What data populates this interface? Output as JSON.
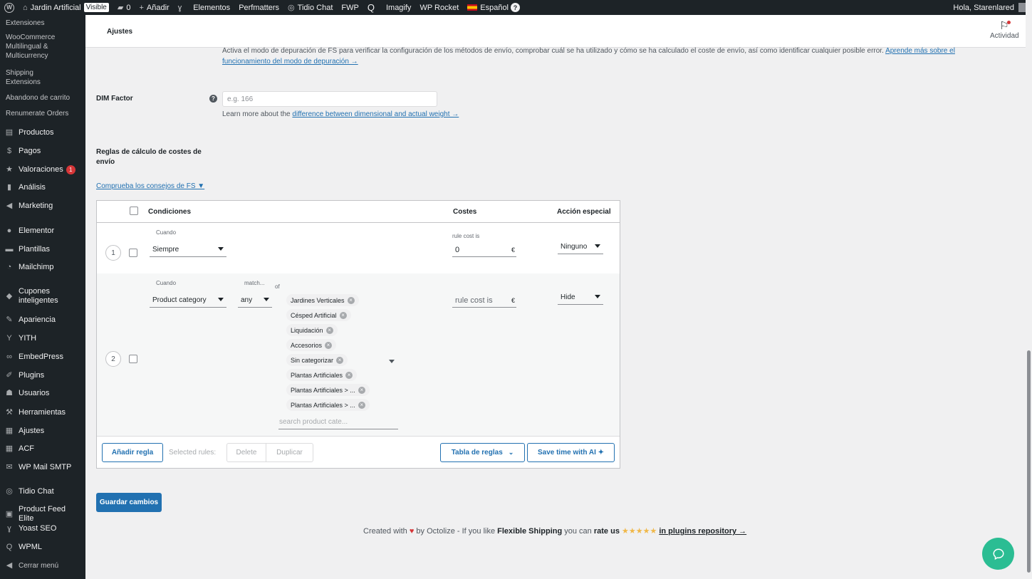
{
  "adminbar": {
    "site_name": "Jardin Artificial",
    "visible_badge": "Visible",
    "comments_count": "0",
    "add_new": "Añadir",
    "items": [
      "Elementos",
      "Perfmatters",
      "Tidio Chat",
      "FWP",
      "Imagify",
      "WP Rocket"
    ],
    "language": "Español",
    "greeting": "Hola, Starenlared"
  },
  "sidebar": {
    "subitems": [
      "Extensiones",
      "WooCommerce Multilingual & Multicurrency",
      "Shipping Extensions",
      "Abandono de carrito",
      "Renumerate Orders"
    ],
    "items": [
      {
        "label": "Productos",
        "icon": "archive-icon"
      },
      {
        "label": "Pagos",
        "icon": "dollar-icon"
      },
      {
        "label": "Valoraciones",
        "icon": "star-icon",
        "badge": "1"
      },
      {
        "label": "Análisis",
        "icon": "bar-chart-icon"
      },
      {
        "label": "Marketing",
        "icon": "megaphone-icon"
      },
      {
        "label": "Elementor",
        "icon": "elementor-icon"
      },
      {
        "label": "Plantillas",
        "icon": "folder-icon"
      },
      {
        "label": "Mailchimp",
        "icon": "mailchimp-icon"
      },
      {
        "label": "Cupones inteligentes",
        "icon": "tag-icon"
      },
      {
        "label": "Apariencia",
        "icon": "paintbrush-icon"
      },
      {
        "label": "YITH",
        "icon": "yith-icon"
      },
      {
        "label": "EmbedPress",
        "icon": "link-icon"
      },
      {
        "label": "Plugins",
        "icon": "plug-icon"
      },
      {
        "label": "Usuarios",
        "icon": "user-icon"
      },
      {
        "label": "Herramientas",
        "icon": "wrench-icon"
      },
      {
        "label": "Ajustes",
        "icon": "settings-icon"
      },
      {
        "label": "ACF",
        "icon": "acf-icon"
      },
      {
        "label": "WP Mail SMTP",
        "icon": "mail-icon"
      },
      {
        "label": "Tidio Chat",
        "icon": "chat-icon"
      },
      {
        "label": "Product Feed Elite",
        "icon": "feed-icon"
      },
      {
        "label": "Yoast SEO",
        "icon": "yoast-icon"
      },
      {
        "label": "WPML",
        "icon": "wpml-icon"
      },
      {
        "label": "Cerrar menú",
        "icon": "collapse-icon"
      }
    ]
  },
  "header": {
    "title": "Ajustes",
    "activity": "Actividad"
  },
  "debug": {
    "text": "Activa el modo de depuración de FS para verificar la configuración de los métodos de envío, comprobar cuál se ha utilizado y cómo se ha calculado el coste de envío, así como identificar cualquier posible error.",
    "link_part1": "Aprende más sobre el",
    "link_part2": "funcionamiento del modo de depuración →"
  },
  "dim": {
    "label": "DIM Factor",
    "placeholder": "e.g. 166",
    "help_prefix": "Learn more about the",
    "help_link": "difference between dimensional and actual weight →"
  },
  "rules_section": {
    "label": "Reglas de cálculo de costes de envío",
    "tips_link": "Comprueba los consejos de FS ▼",
    "headers": {
      "conditions": "Condiciones",
      "costs": "Costes",
      "special": "Acción especial"
    },
    "rule1": {
      "number": "1",
      "when_label": "Cuando",
      "when_value": "Siempre",
      "cost_label": "rule cost is",
      "cost_value": "0",
      "currency": "€",
      "action": "Ninguno"
    },
    "rule2": {
      "number": "2",
      "when_label": "Cuando",
      "when_value": "Product category",
      "match_label": "match...",
      "match_value": "any",
      "of_label": "of",
      "chips": [
        "Jardines Verticales",
        "Césped Artificial",
        "Liquidación",
        "Accesorios",
        "Sin categorizar",
        "Plantas Artificiales",
        "Plantas Artificiales > ...",
        "Plantas Artificiales > ..."
      ],
      "search_placeholder": "search product cate...",
      "cost_placeholder": "rule cost is",
      "currency": "€",
      "action": "Hide"
    },
    "footer": {
      "add_rule": "Añadir regla",
      "selected_rules": "Selected rules:",
      "delete": "Delete",
      "duplicate": "Duplicar",
      "rules_table": "Tabla de reglas",
      "ai": "Save time with AI ✦"
    }
  },
  "save_button": "Guardar cambios",
  "credits": {
    "created_with": "Created with",
    "heart": "♥",
    "by": "by Octolize - If you like",
    "plugin": "Flexible Shipping",
    "you_can": "you can",
    "rate": "rate us",
    "stars": "★★★★★",
    "link": "in plugins repository →"
  }
}
